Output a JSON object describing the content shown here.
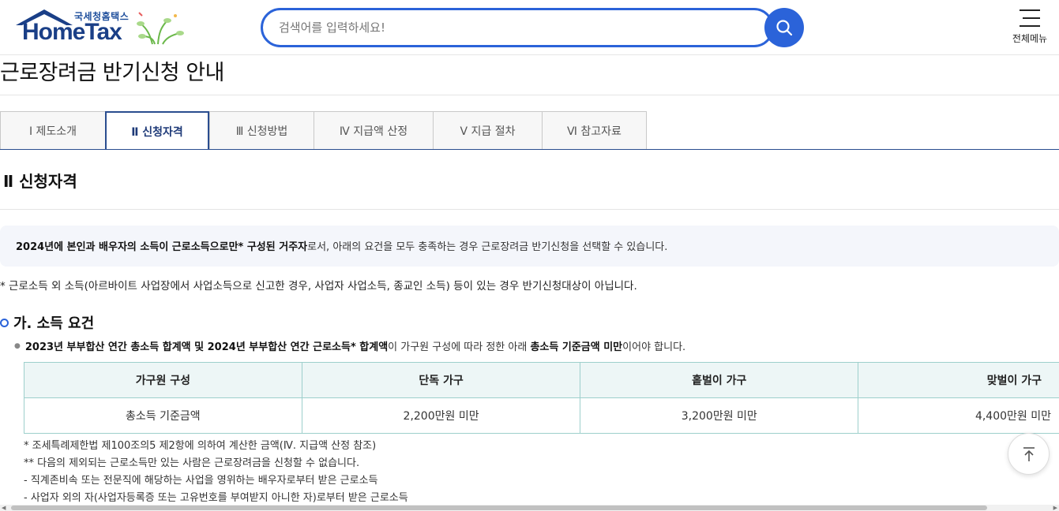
{
  "header": {
    "logo_sub": "국세청홈택스",
    "logo_main": "HomeTax",
    "search_placeholder": "검색어를 입력하세요!",
    "menu_label": "전체메뉴"
  },
  "page": {
    "title": "근로장려금 반기신청 안내"
  },
  "tabs": [
    {
      "label": "Ⅰ 제도소개"
    },
    {
      "label": "Ⅱ 신청자격"
    },
    {
      "label": "Ⅲ 신청방법"
    },
    {
      "label": "Ⅳ 지급액 산정"
    },
    {
      "label": "Ⅴ 지급 절차"
    },
    {
      "label": "Ⅵ 참고자료"
    }
  ],
  "section": {
    "title": "Ⅱ 신청자격",
    "notice_bold": "2024년에 본인과 배우자의 소득이 근로소득으로만* 구성된 거주자",
    "notice_rest": "로서, 아래의 요건을 모두 충족하는 경우 근로장려금 반기신청을 선택할 수 있습니다.",
    "note": "* 근로소득 외 소득(아르바이트 사업장에서 사업소득으로 신고한 경우, 사업자 사업소득, 종교인 소득) 등이 있는 경우 반기신청대상이 아닙니다."
  },
  "income": {
    "title": "가. 소득 요건",
    "bullet_b1": "2023년 부부합산 연간 총소득 합계액 및 2024년 부부합산 연간 근로소득* 합계액",
    "bullet_t1": "이 가구원 구성에 따라 정한 아래 ",
    "bullet_b2": "총소득 기준금액 미만",
    "bullet_t2": "이어야 합니다.",
    "table": {
      "headers": [
        "가구원 구성",
        "단독 가구",
        "홑벌이 가구",
        "맞벌이 가구"
      ],
      "row": [
        "총소득 기준금액",
        "2,200만원 미만",
        "3,200만원 미만",
        "4,400만원 미만"
      ]
    },
    "footnotes": [
      "* 조세특례제한법 제100조의5 제2항에 의하여 계산한 금액(Ⅳ. 지급액 산정 참조)",
      "** 다음의 제외되는 근로소득만 있는 사람은 근로장려금을 신청할 수 없습니다.",
      "- 직계존비속 또는 전문직에 해당하는 사업을 영위하는 배우자로부터 받은 근로소득",
      "- 사업자 외의 자(사업자등록증 또는 고유번호를 부여받지 아니한 자)로부터 받은 근로소득"
    ]
  },
  "icons": {
    "search": "search-icon",
    "menu": "hamburger-icon",
    "top": "arrow-up-icon"
  },
  "colors": {
    "brand": "#1a3f87",
    "accent": "#2b63d9",
    "table_border": "#9dcfcc",
    "table_header_bg": "#edf6f6"
  }
}
